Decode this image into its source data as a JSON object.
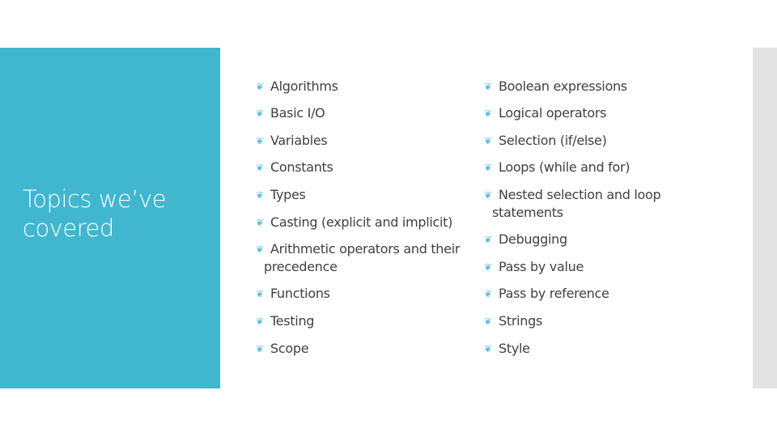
{
  "slide": {
    "title": "Topics we’ve covered",
    "title_lines": [
      "Topics we’ve",
      "covered"
    ],
    "colors": {
      "accent_panel": "#41b6cf",
      "side_strip": "#e3e3e3",
      "body_text": "#404040",
      "bullet": "#41b6cf"
    },
    "bullet_icon": "curl-bullet-icon",
    "bullet_glyph": "❦",
    "left_column": [
      {
        "label": "Algorithms"
      },
      {
        "label": "Basic I/O"
      },
      {
        "label": "Variables"
      },
      {
        "label": "Constants"
      },
      {
        "label": "Types"
      },
      {
        "label": "Casting (explicit and implicit)"
      },
      {
        "label": "Arithmetic operators and their",
        "continuation": "precedence"
      },
      {
        "label": "Functions"
      },
      {
        "label": "Testing"
      },
      {
        "label": "Scope"
      }
    ],
    "right_column": [
      {
        "label": "Boolean expressions"
      },
      {
        "label": "Logical operators"
      },
      {
        "label": "Selection (if/else)"
      },
      {
        "label": "Loops (while and for)"
      },
      {
        "label": "Nested selection and loop",
        "continuation": "statements"
      },
      {
        "label": "Debugging"
      },
      {
        "label": "Pass by value"
      },
      {
        "label": "Pass by reference"
      },
      {
        "label": "Strings"
      },
      {
        "label": "Style"
      }
    ]
  }
}
